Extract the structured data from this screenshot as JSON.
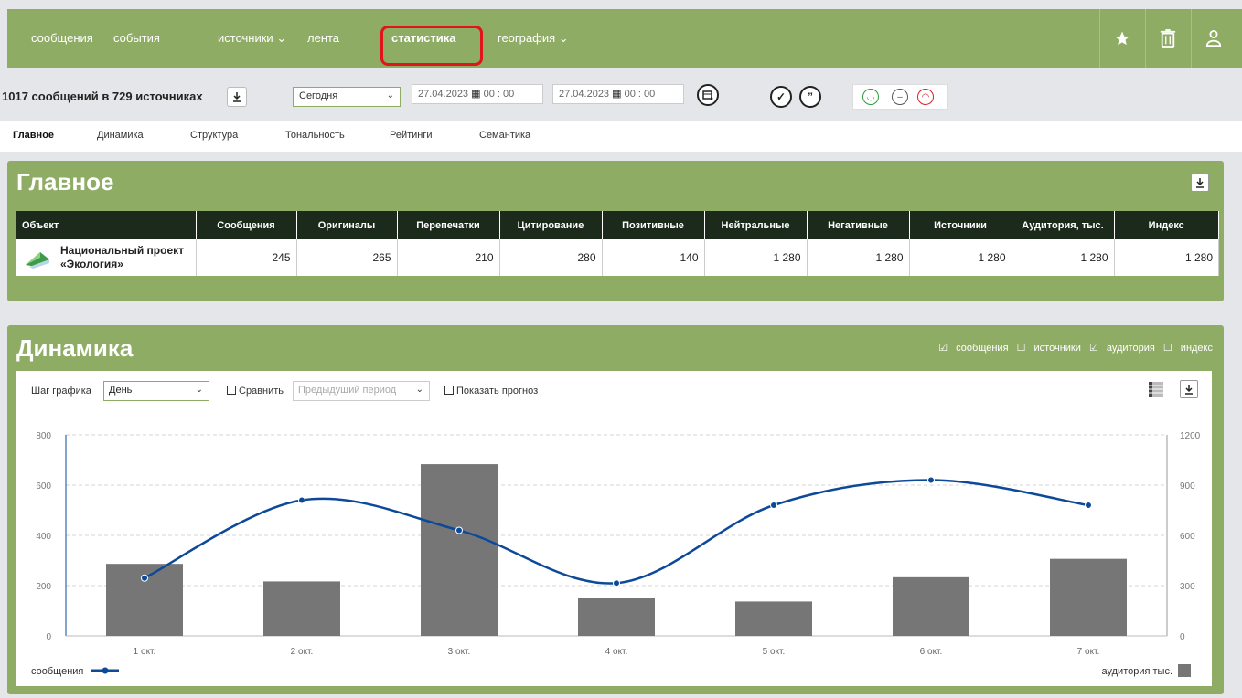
{
  "nav": {
    "items": [
      "сообщения",
      "события",
      "источники",
      "лента",
      "статистика",
      "география"
    ],
    "active": "статистика"
  },
  "toolbar": {
    "count_text": "1017 сообщений в 729 источниках",
    "period": "Сегодня",
    "date_from": "27.04.2023",
    "time_from": "00 : 00",
    "date_to": "27.04.2023",
    "time_to": "00 : 00"
  },
  "tabs": [
    "Главное",
    "Динамика",
    "Структура",
    "Тональность",
    "Рейтинги",
    "Семантика"
  ],
  "main_panel": {
    "title": "Главное",
    "columns": [
      "Объект",
      "Сообщения",
      "Оригиналы",
      "Перепечатки",
      "Цитирование",
      "Позитивные",
      "Нейтральные",
      "Негативные",
      "Источники",
      "Аудитория, тыс.",
      "Индекс"
    ],
    "row": {
      "object_line1": "Национальный проект",
      "object_line2": "«Экология»",
      "values": [
        "245",
        "265",
        "210",
        "280",
        "140",
        "1 280",
        "1 280",
        "1 280",
        "1 280",
        "1 280"
      ]
    }
  },
  "dynamics": {
    "title": "Динамика",
    "metrics": [
      {
        "label": "сообщения",
        "checked": true
      },
      {
        "label": "источники",
        "checked": false
      },
      {
        "label": "аудитория",
        "checked": true
      },
      {
        "label": "индекс",
        "checked": false
      }
    ],
    "step_label": "Шаг графика",
    "step_value": "День",
    "compare_label": "Сравнить",
    "compare_value": "Предыдущий период",
    "forecast_label": "Показать прогноз",
    "legend_left": "сообщения",
    "legend_right": "аудитория тыс."
  },
  "chart_data": {
    "type": "bar",
    "categories": [
      "1 окт.",
      "2 окт.",
      "3 окт.",
      "4 окт.",
      "5 окт.",
      "6 окт.",
      "7 окт."
    ],
    "series": [
      {
        "name": "аудитория тыс.",
        "type": "bar",
        "axis": "right",
        "values": [
          430,
          325,
          1025,
          225,
          205,
          350,
          460
        ]
      },
      {
        "name": "сообщения",
        "type": "line",
        "axis": "left",
        "values": [
          230,
          540,
          420,
          210,
          520,
          620,
          520
        ]
      }
    ],
    "left_axis": {
      "ylim": [
        0,
        800
      ],
      "ticks": [
        0,
        200,
        400,
        600,
        800
      ]
    },
    "right_axis": {
      "ylim": [
        0,
        1200
      ],
      "ticks": [
        0,
        300,
        600,
        900,
        1200
      ]
    },
    "grid": true,
    "legend": "bottom",
    "colors": {
      "bar": "#767676",
      "line": "#0c4a99"
    }
  }
}
